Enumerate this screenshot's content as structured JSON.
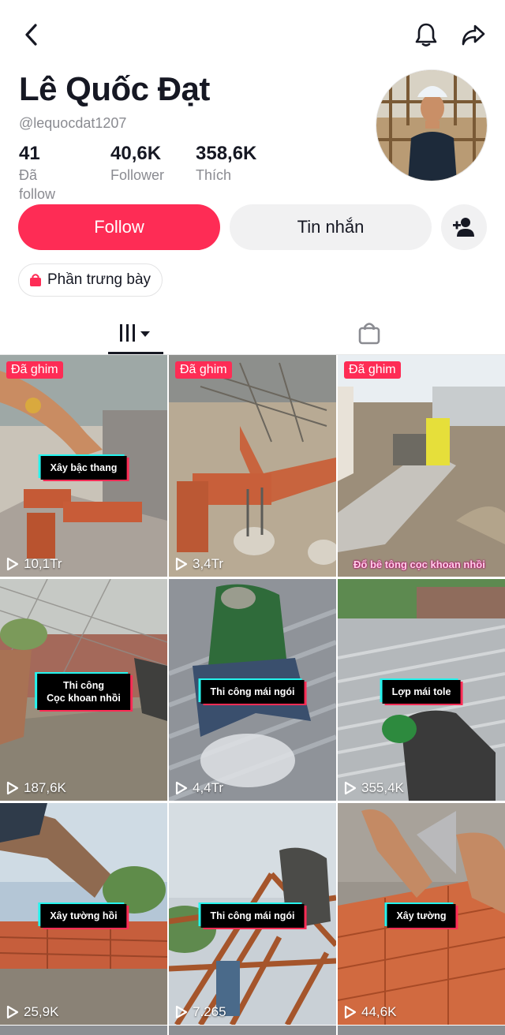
{
  "header": {
    "back_icon": "chevron-left-icon",
    "bell_icon": "bell-icon",
    "share_icon": "share-arrow-icon"
  },
  "profile": {
    "name": "Lê Quốc Đạt",
    "handle": "@lequocdat1207",
    "stats": [
      {
        "value": "41",
        "label": "Đã follow"
      },
      {
        "value": "40,6K",
        "label": "Follower"
      },
      {
        "value": "358,6K",
        "label": "Thích"
      }
    ]
  },
  "actions": {
    "follow_label": "Follow",
    "message_label": "Tin nhắn",
    "add_friend_icon": "add-user-icon",
    "showcase_label": "Phần trưng bày"
  },
  "colors": {
    "accent": "#fe2c55",
    "secondary_bg": "#f1f1f2",
    "muted_text": "#8a8b91",
    "caption_cyan": "#25f4ee"
  },
  "videos": [
    {
      "pinned": "Đã ghim",
      "caption": "Xây bậc thang",
      "views": "10,1Tr"
    },
    {
      "pinned": "Đã ghim",
      "caption": "",
      "views": "3,4Tr"
    },
    {
      "pinned": "Đã ghim",
      "caption": "",
      "views": "",
      "overlay_text": "Đổ bê tông cọc khoan nhồi"
    },
    {
      "pinned": "",
      "caption": "Thi công\nCọc khoan nhồi",
      "views": "187,6K"
    },
    {
      "pinned": "",
      "caption": "Thi công mái ngói",
      "views": "4,4Tr"
    },
    {
      "pinned": "",
      "caption": "Lợp mái tole",
      "views": "355,4K"
    },
    {
      "pinned": "",
      "caption": "Xây tường hồi",
      "views": "25,9K"
    },
    {
      "pinned": "",
      "caption": "Thi công mái ngói",
      "views": "7.265"
    },
    {
      "pinned": "",
      "caption": "Xây tường",
      "views": "44,6K"
    }
  ]
}
